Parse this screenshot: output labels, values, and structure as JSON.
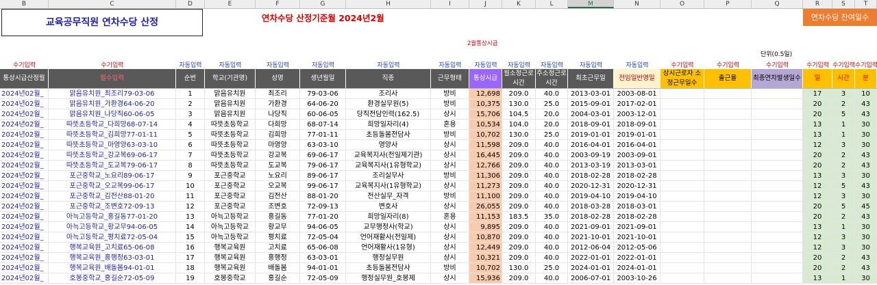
{
  "columns": [
    "B",
    "C",
    "D",
    "E",
    "F",
    "G",
    "H",
    "I",
    "J",
    "K",
    "L",
    "M",
    "N",
    "O",
    "P",
    "Q",
    "R",
    "S",
    "T"
  ],
  "title": "교육공무직원 연차수당 산정",
  "base_month_label": "연차수당 산정기준월 2024년2월",
  "remain_button": "연차수당 잔여일수",
  "wage_note": "2월통상시급",
  "unit_note": "단위(0.5일)",
  "meta": [
    "수기입력",
    "수기입력",
    "자동입력",
    "자동입력",
    "자동입력",
    "자동입력",
    "자동입력",
    "자동입력",
    "자동입력",
    "자동입력",
    "자동입력",
    "자동입력",
    "자동입력",
    "수기입력",
    "수기입력",
    "수기입력",
    "수기입력",
    "수기입력",
    "수기입력"
  ],
  "headers": [
    "통상시급산정월",
    "필수입력",
    "순번",
    "학교(기관명)",
    "성명",
    "생년월일",
    "직종",
    "근무형태",
    "통상시급",
    "월소정근로시간",
    "주소정근로시간",
    "최초근무일",
    "전임일반영일",
    "상시근로자 소정근무일수",
    "출근율",
    "최종연차발생일수",
    "일",
    "시간",
    "분"
  ],
  "rows": [
    [
      "2024년02월_",
      "맑음유치원_최조리79-03-06",
      "1",
      "맑음유치원",
      "최조리",
      "79-03-06",
      "조리사",
      "방비",
      "12,698",
      "209.0",
      "40.0",
      "2013-03-01",
      "2003-08-01",
      "17",
      "3",
      "10"
    ],
    [
      "2024년02월_",
      "맑음유치원_가환경64-06-20",
      "2",
      "맑음유치원",
      "가환경",
      "64-06-20",
      "환경실무원(5)",
      "방비",
      "10,375",
      "130.0",
      "25.0",
      "2015-09-01",
      "2017-02-01",
      "20",
      "2",
      "43"
    ],
    [
      "2024년02월_",
      "맑음유치원_나당직60-06-05",
      "3",
      "맑음유치원",
      "나당직",
      "60-06-05",
      "당직전담인력(162.5)",
      "상시",
      "15,706",
      "104.5",
      "20.0",
      "2004-03-01",
      "2003-12-01",
      "20",
      "5",
      "43"
    ],
    [
      "2024년02월_",
      "따뜻초등학교_다희망68-07-14",
      "4",
      "따뜻초등학교",
      "다희망",
      "68-07-14",
      "희망일자리(4)",
      "혼용",
      "10,534",
      "104.0",
      "20.0",
      "2018-09-01",
      "2018-09-01",
      "13",
      "1",
      "30"
    ],
    [
      "2024년02월_",
      "따뜻초등학교_김희망77-01-11",
      "5",
      "따뜻초등학교",
      "김희망",
      "77-01-11",
      "초등돌봄전담사",
      "방비",
      "10,702",
      "130.0",
      "25.0",
      "2019-01-01",
      "2019-01-01",
      "13",
      "1",
      "30"
    ],
    [
      "2024년02월_",
      "따뜻초등학교_마영양63-03-10",
      "6",
      "따뜻초등학교",
      "마영양",
      "63-03-10",
      "영양사",
      "상시",
      "11,598",
      "209.0",
      "40.0",
      "2016-04-01",
      "2016-04-01",
      "12",
      "3",
      "30"
    ],
    [
      "2024년02월_",
      "따뜻초등학교_강교복69-06-17",
      "7",
      "따뜻초등학교",
      "강교복",
      "69-06-17",
      "교육복지사(전일제기관)",
      "상시",
      "16,445",
      "209.0",
      "40.0",
      "2003-09-19",
      "2003-09-01",
      "20",
      "2",
      "43"
    ],
    [
      "2024년02월_",
      "따뜻초등학교_도교복79-06-17",
      "8",
      "따뜻초등학교",
      "도교복",
      "79-06-17",
      "교육복지사(1유형학교)",
      "상시",
      "12,766",
      "209.0",
      "40.0",
      "2013-03-19",
      "2013-03-01",
      "20",
      "2",
      "43"
    ],
    [
      "2024년02월_",
      "포근중학교_노요리89-06-17",
      "9",
      "포근중학교",
      "노요리",
      "89-06-17",
      "조리실무사",
      "방비",
      "11,306",
      "209.0",
      "40.0",
      "2018-02-28",
      "2018-02-28",
      "13",
      "3",
      "30"
    ],
    [
      "2024년02월_",
      "포근중학교_오교복99-06-17",
      "10",
      "포근중학교",
      "오교복",
      "99-06-17",
      "교육복지사(1유형학교)",
      "상시",
      "11,273",
      "209.0",
      "40.0",
      "2020-12-31",
      "2020-12-31",
      "12",
      "5",
      "43"
    ],
    [
      "2024년02월_",
      "포근중학교_김전산88-01-20",
      "11",
      "포근중학교",
      "김전산",
      "88-01-20",
      "전산실무_자격",
      "방비",
      "11,100",
      "209.0",
      "40.0",
      "2019-04-10",
      "2019-04-10",
      "12",
      "3",
      "30"
    ],
    [
      "2024년02월_",
      "포근중학교_조변호72-09-13",
      "12",
      "포근중학교",
      "조변호",
      "72-09-13",
      "변호사",
      "상시",
      "26,055",
      "209.0",
      "40.0",
      "2018-03-28",
      "2018-03-01",
      "20",
      "5",
      "45"
    ],
    [
      "2024년02월_",
      "아늑고등학교_홍길동77-01-20",
      "13",
      "아늑고등학교",
      "홍길동",
      "77-01-20",
      "희망일자리(8)",
      "혼용",
      "11,153",
      "183.5",
      "35.0",
      "2018-02-28",
      "2018-02-28",
      "20",
      "2",
      "43"
    ],
    [
      "2024년02월_",
      "아늑고등학교_황교무94-06-05",
      "14",
      "아늑고등학교",
      "황교무",
      "94-06-05",
      "교무행정사(학교)",
      "상시",
      "9,895",
      "209.0",
      "40.0",
      "2021-09-01",
      "2021-09-01",
      "13",
      "1",
      "30"
    ],
    [
      "2024년02월_",
      "아늑고등학교_평치료72-05-04",
      "15",
      "아늑고등학교",
      "평치료",
      "72-05-04",
      "언어재활사(전일제)",
      "상시",
      "10,870",
      "209.0",
      "40.0",
      "2021-10-01",
      "2021-10-01",
      "12",
      "3",
      "30"
    ],
    [
      "2024년02월_",
      "행복교육원_고치료65-06-08",
      "16",
      "행복교육원",
      "고치료",
      "65-06-08",
      "언어재활사(1유형)",
      "상시",
      "12,449",
      "209.0",
      "40.0",
      "2012-06-04",
      "2012-05-06",
      "12",
      "3",
      "30"
    ],
    [
      "2024년02월_",
      "행복교육원_홍행정63-03-01",
      "17",
      "행복교육원",
      "홍행정",
      "63-03-01",
      "행정실무원",
      "상시",
      "10,321",
      "209.0",
      "40.0",
      "2022-01-01",
      "2022-01-01",
      "20",
      "2",
      "43"
    ],
    [
      "2024년02월_",
      "행복교육원_배돌봄94-01-01",
      "18",
      "행복교육원",
      "배돌봄",
      "94-01-01",
      "초등돌봄전담사",
      "방비",
      "10,702",
      "130.0",
      "25.0",
      "2024-01-01",
      "2024-01-01",
      "20",
      "2",
      "43"
    ],
    [
      "2024년02월_",
      "호봉중학교_홍길순72-05-09",
      "19",
      "호봉중학교",
      "홍길순",
      "72-05-09",
      "행정실무원_호봉제",
      "상시",
      "15,936",
      "209.0",
      "40.0",
      "2006-07-01",
      "2003-10-26",
      "13",
      "1",
      "30"
    ]
  ]
}
